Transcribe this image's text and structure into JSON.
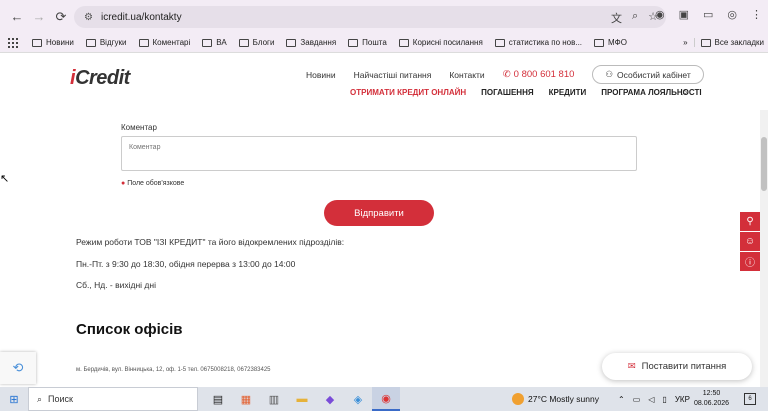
{
  "browser": {
    "url": "icredit.ua/kontakty",
    "bookmarks": [
      "Новини",
      "Відгуки",
      "Коментарі",
      "ВА",
      "Блоги",
      "Завдання",
      "Пошта",
      "Корисні посилання",
      "статистика по нов...",
      "МФО"
    ],
    "more": "»",
    "all_bookmarks": "Все закладки"
  },
  "site": {
    "logo_i": "i",
    "logo_rest": "Credit",
    "top_links": [
      "Новини",
      "Найчастіші питання",
      "Контакти"
    ],
    "phone": "0 800 601 810",
    "cabinet": "Особистий кабінет",
    "main_nav": [
      "ОТРИМАТИ КРЕДИТ ОНЛАЙН",
      "ПОГАШЕННЯ",
      "КРЕДИТИ",
      "ПРОГРАМА ЛОЯЛЬНОСТІ"
    ],
    "accent": "#d32f3a"
  },
  "form": {
    "label": "Коментар",
    "placeholder": "Коментар",
    "required_note": "Поле обов'язкове",
    "submit": "Відправити"
  },
  "info": {
    "schedule_title": "Режим роботи ТОВ \"ІЗІ КРЕДИТ\" та його відокремлених підрозділів:",
    "weekdays": "Пн.-Пт. з 9:30 до 18:30, обідня перерва з 13:00 до 14:00",
    "weekend": "Сб., Нд. - вихідні дні",
    "offices_title": "Список офісів",
    "office_line": "м. Бердичів, вул. Вінницька, 12, оф. 1-5 тел. 0675008218, 0672383425"
  },
  "widget": {
    "ask": "Поставити питання"
  },
  "taskbar": {
    "search": "Поиск",
    "weather": "27°C  Mostly sunny",
    "lang": "УКР",
    "time": "12:50",
    "date": "08.06.2026",
    "notif_count": "6"
  }
}
